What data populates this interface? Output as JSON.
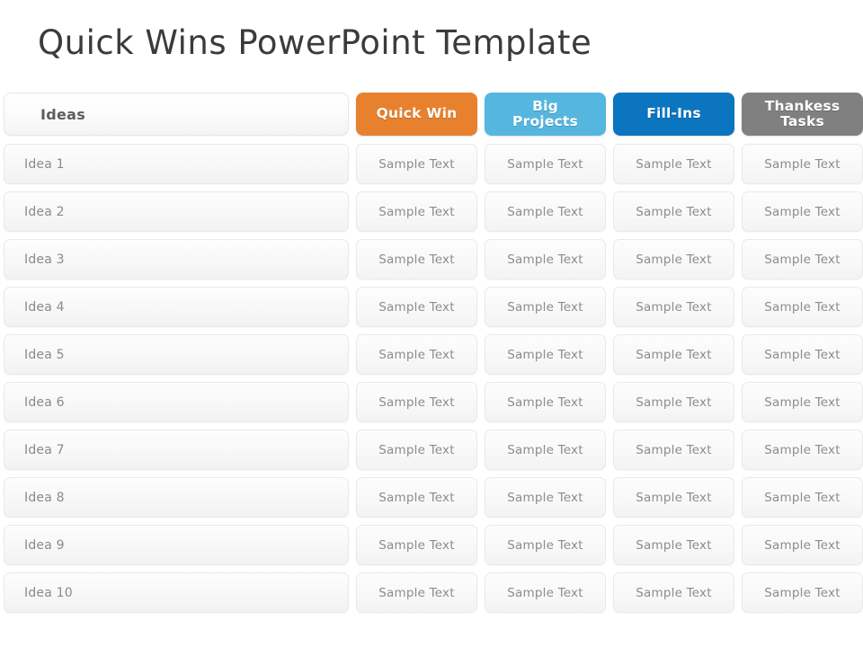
{
  "slide": {
    "title": "Quick Wins PowerPoint Template",
    "title_color": "#3b3b3b",
    "background": "#ffffff"
  },
  "matrix": {
    "ideas_column_header": "Ideas",
    "category_headers": [
      {
        "label_line1": "Quick Win",
        "label_line2": "",
        "color": "#e8812e"
      },
      {
        "label_line1": "Big",
        "label_line2": "Projects",
        "color": "#55b6e0"
      },
      {
        "label_line1": "Fill-Ins",
        "label_line2": "",
        "color": "#0c75c0"
      },
      {
        "label_line1": "Thankess",
        "label_line2": "Tasks",
        "color": "#808080"
      }
    ],
    "sample_cell_text": "Sample Text",
    "rows": [
      {
        "idea": "Idea 1",
        "cells": [
          "Sample Text",
          "Sample Text",
          "Sample Text",
          "Sample Text"
        ]
      },
      {
        "idea": "Idea 2",
        "cells": [
          "Sample Text",
          "Sample Text",
          "Sample Text",
          "Sample Text"
        ]
      },
      {
        "idea": "Idea 3",
        "cells": [
          "Sample Text",
          "Sample Text",
          "Sample Text",
          "Sample Text"
        ]
      },
      {
        "idea": "Idea 4",
        "cells": [
          "Sample Text",
          "Sample Text",
          "Sample Text",
          "Sample Text"
        ]
      },
      {
        "idea": "Idea 5",
        "cells": [
          "Sample Text",
          "Sample Text",
          "Sample Text",
          "Sample Text"
        ]
      },
      {
        "idea": "Idea 6",
        "cells": [
          "Sample Text",
          "Sample Text",
          "Sample Text",
          "Sample Text"
        ]
      },
      {
        "idea": "Idea 7",
        "cells": [
          "Sample Text",
          "Sample Text",
          "Sample Text",
          "Sample Text"
        ]
      },
      {
        "idea": "Idea 8",
        "cells": [
          "Sample Text",
          "Sample Text",
          "Sample Text",
          "Sample Text"
        ]
      },
      {
        "idea": "Idea 9",
        "cells": [
          "Sample Text",
          "Sample Text",
          "Sample Text",
          "Sample Text"
        ]
      },
      {
        "idea": "Idea 10",
        "cells": [
          "Sample Text",
          "Sample Text",
          "Sample Text",
          "Sample Text"
        ]
      }
    ]
  }
}
